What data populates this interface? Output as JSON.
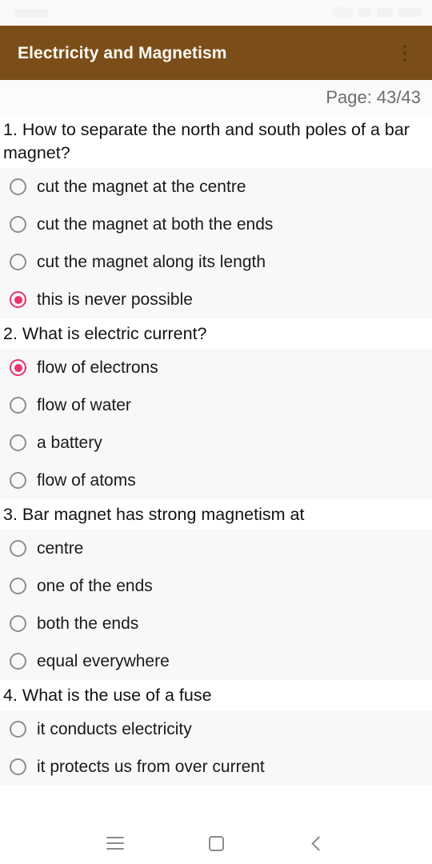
{
  "status_bar": {
    "icons": [
      "carrier-text",
      "wifi-icon",
      "signal-icon",
      "battery-icon"
    ]
  },
  "appbar": {
    "title": "Electricity and Magnetism",
    "overflow_icon": "more-vertical-icon",
    "background_color": "#7b4e19",
    "title_color": "#fdfaf4"
  },
  "page_indicator": {
    "text": "Page: 43/43",
    "current": 43,
    "total": 43
  },
  "theme": {
    "accent_color": "#e8336b",
    "option_background": "#f8f8f8",
    "question_background": "#ffffff"
  },
  "questions": [
    {
      "number": "1.",
      "text": "1. How to separate the north and south poles of a bar magnet?",
      "options": [
        {
          "label": "cut the magnet at the centre",
          "selected": false
        },
        {
          "label": "cut the magnet at both the ends",
          "selected": false
        },
        {
          "label": "cut the magnet along its length",
          "selected": false
        },
        {
          "label": "this is never possible",
          "selected": true
        }
      ]
    },
    {
      "number": "2.",
      "text": "2. What is electric current?",
      "options": [
        {
          "label": "flow of electrons",
          "selected": true
        },
        {
          "label": "flow of water",
          "selected": false
        },
        {
          "label": "a battery",
          "selected": false
        },
        {
          "label": "flow of atoms",
          "selected": false
        }
      ]
    },
    {
      "number": "3.",
      "text": "3. Bar magnet has strong magnetism at",
      "options": [
        {
          "label": "centre",
          "selected": false
        },
        {
          "label": "one of the ends",
          "selected": false
        },
        {
          "label": "both the ends",
          "selected": false
        },
        {
          "label": "equal everywhere",
          "selected": false
        }
      ]
    },
    {
      "number": "4.",
      "text": "4. What is the use of a fuse",
      "options": [
        {
          "label": "it conducts electricity",
          "selected": false
        },
        {
          "label": "it protects us from over current",
          "selected": false
        }
      ]
    }
  ],
  "navbar": {
    "buttons": [
      {
        "icon": "recents-icon"
      },
      {
        "icon": "home-icon"
      },
      {
        "icon": "back-icon"
      }
    ]
  }
}
